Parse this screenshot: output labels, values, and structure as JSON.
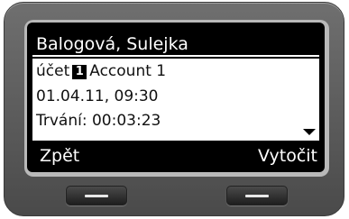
{
  "header": {
    "contact_name": "Balogová, Sulejka"
  },
  "details": {
    "account_prefix": "účet",
    "account_number": "1",
    "account_name": "Account 1",
    "datetime": "01.04.11, 09:30",
    "duration": "Trvání: 00:03:23"
  },
  "softkeys": {
    "left_label": "Zpět",
    "right_label": "Vytočit"
  },
  "icons": {
    "scroll_indicator": "triangle-down-icon",
    "hardware_key": "minus-icon"
  },
  "colors": {
    "screen_background": "#000000",
    "content_background": "#ffffff",
    "device_body": "#5b5b5b"
  }
}
